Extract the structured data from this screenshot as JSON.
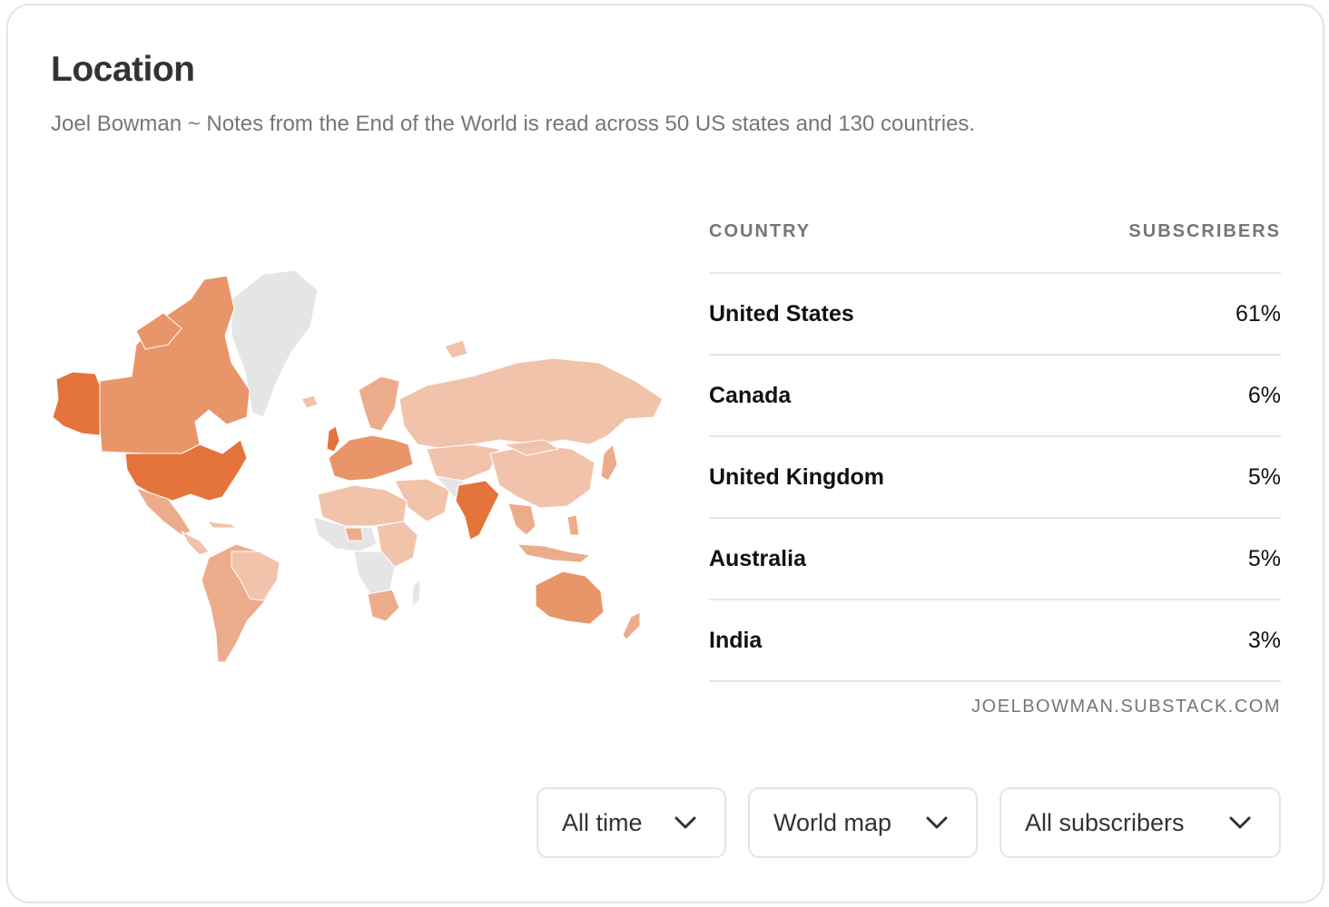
{
  "header": {
    "title": "Location",
    "subtitle": "Joel Bowman ~ Notes from the End of the World is read across 50 US states and 130 countries."
  },
  "table": {
    "col_country": "COUNTRY",
    "col_subscribers": "SUBSCRIBERS",
    "rows": [
      {
        "country": "United States",
        "share": "61%"
      },
      {
        "country": "Canada",
        "share": "6%"
      },
      {
        "country": "United Kingdom",
        "share": "5%"
      },
      {
        "country": "Australia",
        "share": "5%"
      },
      {
        "country": "India",
        "share": "3%"
      }
    ],
    "source": "JOELBOWMAN.SUBSTACK.COM"
  },
  "filters": {
    "time": "All time",
    "view": "World map",
    "audience": "All subscribers"
  },
  "colors": {
    "highest": "#e4733c",
    "high": "#e9956a",
    "medium": "#ecac8b",
    "low": "#f1c3aa",
    "none": "#e5e5e5"
  },
  "icons": {
    "dropdown": "chevron-down-icon"
  }
}
